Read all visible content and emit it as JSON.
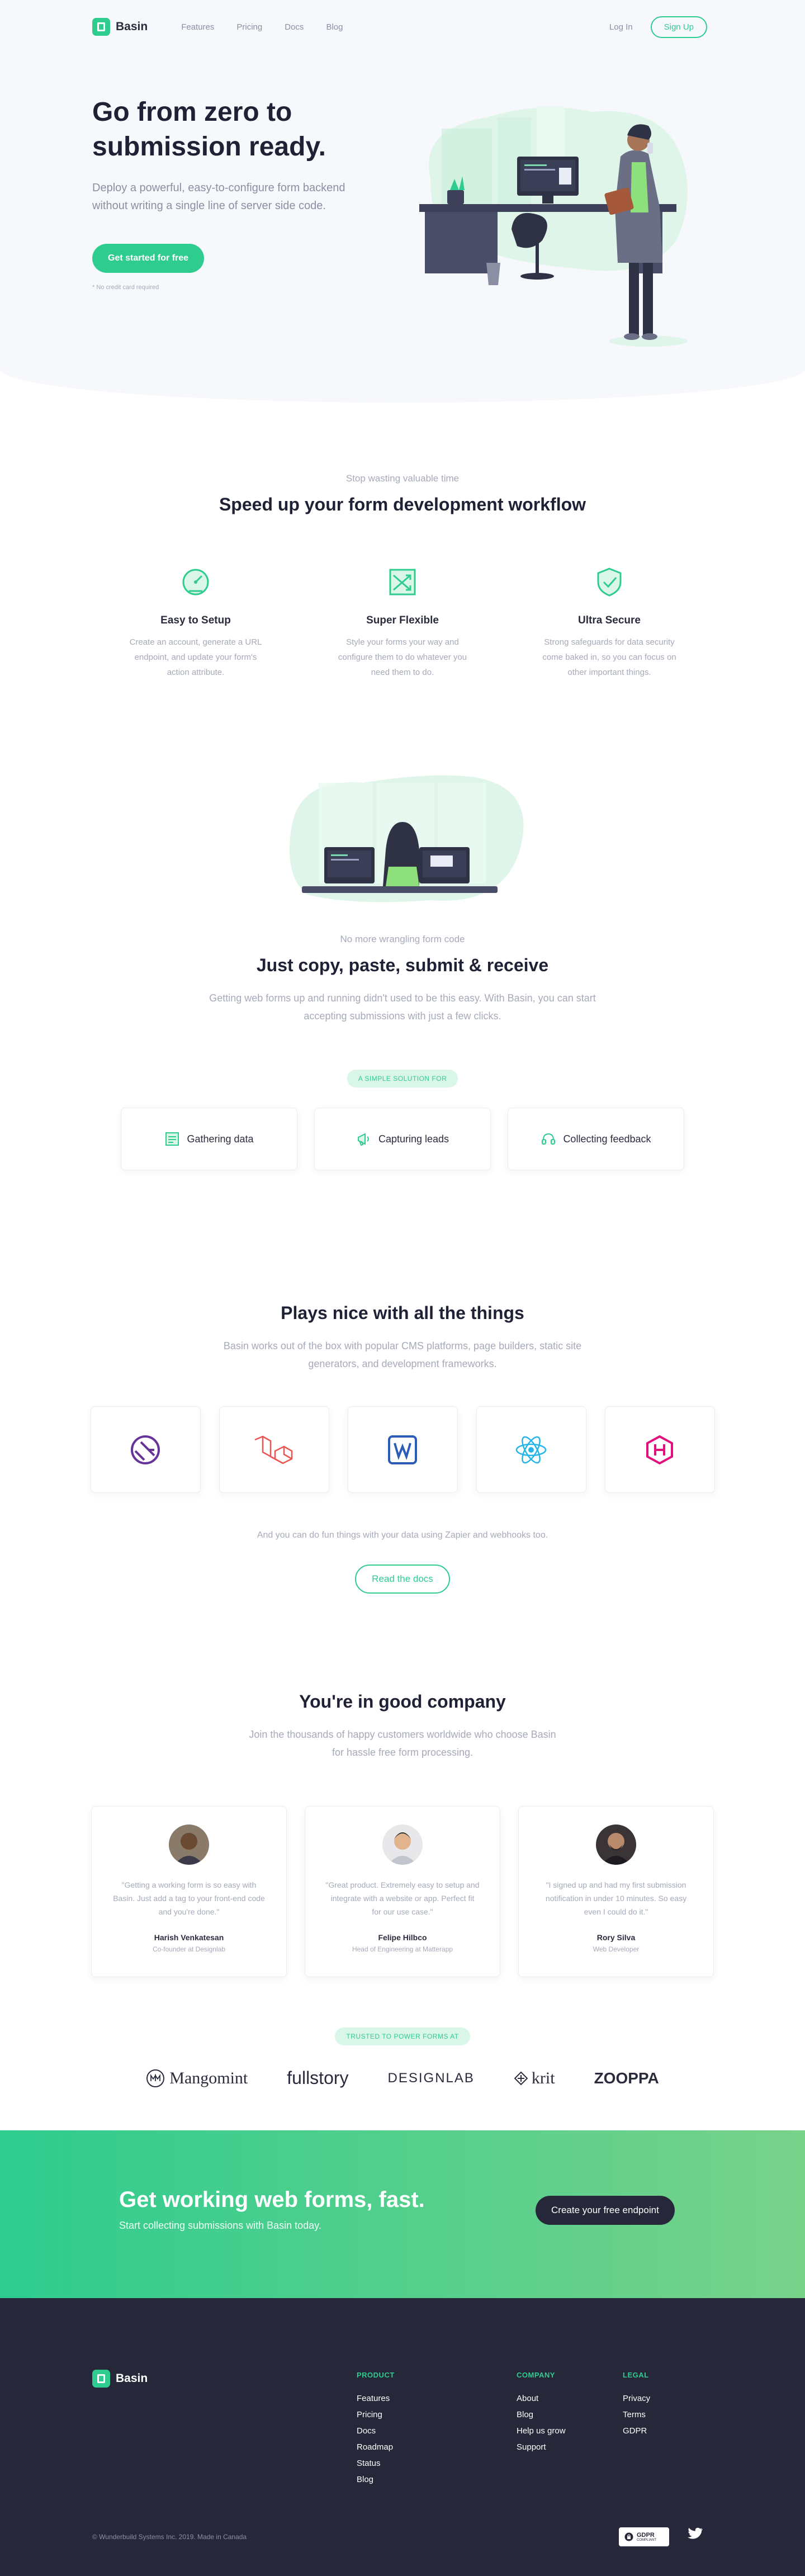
{
  "nav": {
    "brand": "Basin",
    "links": [
      "Features",
      "Pricing",
      "Docs",
      "Blog"
    ],
    "login": "Log In",
    "signup": "Sign Up"
  },
  "hero": {
    "title": "Go from zero to submission ready.",
    "subtitle": "Deploy a powerful, easy-to-configure form backend without writing a single line of server side code.",
    "cta": "Get started for free",
    "note": "* No credit card required"
  },
  "workflow": {
    "eyebrow": "Stop wasting valuable time",
    "title": "Speed up your form development workflow",
    "features": [
      {
        "title": "Easy to Setup",
        "desc": "Create an account, generate a URL endpoint, and update your form's action attribute.",
        "icon": "gauge-icon"
      },
      {
        "title": "Super Flexible",
        "desc": "Style your forms your way and configure them to do whatever you need them to do.",
        "icon": "shuffle-icon"
      },
      {
        "title": "Ultra Secure",
        "desc": "Strong safeguards for data security come baked in, so you can focus on other important things.",
        "icon": "shield-check-icon"
      }
    ]
  },
  "copy_paste": {
    "eyebrow": "No more wrangling form code",
    "title": "Just copy, paste, submit & receive",
    "subtitle": "Getting web forms up and running didn't used to be this easy. With Basin, you can start accepting submissions with just a few clicks.",
    "pill": "A SIMPLE SOLUTION FOR",
    "cards": [
      {
        "label": "Gathering data",
        "icon": "form-icon"
      },
      {
        "label": "Capturing leads",
        "icon": "megaphone-icon"
      },
      {
        "label": "Collecting feedback",
        "icon": "headset-icon"
      }
    ]
  },
  "integrations": {
    "title": "Plays nice with all the things",
    "subtitle": "Basin works out of the box with popular CMS platforms, page builders, static site generators, and development frameworks.",
    "items": [
      "gatsby-icon",
      "laravel-icon",
      "wordpress-icon",
      "react-icon",
      "hugo-icon"
    ],
    "note": "And you can do fun things with your data using Zapier and webhooks too.",
    "button": "Read the docs"
  },
  "testimonials": {
    "title": "You're in good company",
    "subtitle": "Join the thousands of happy customers worldwide who choose Basin for hassle free form processing.",
    "items": [
      {
        "quote": "\"Getting a working form is so easy with Basin. Just add a tag to your front-end code and you're done.\"",
        "name": "Harish Venkatesan",
        "role": "Co-founder at Designlab"
      },
      {
        "quote": "\"Great product. Extremely easy to setup and integrate with a website or app. Perfect fit for our use case.\"",
        "name": "Felipe Hilbco",
        "role": "Head of Engineering at Matterapp"
      },
      {
        "quote": "\"I signed up and had my first submission notification in under 10 minutes. So easy even I could do it.\"",
        "name": "Rory Silva",
        "role": "Web Developer"
      }
    ],
    "pill": "TRUSTED TO POWER FORMS AT",
    "logos": [
      "Mangomint",
      "fullstory",
      "DESIGNLAB",
      "krit",
      "ZOOPPA"
    ]
  },
  "cta": {
    "title": "Get working web forms, fast.",
    "subtitle": "Start collecting submissions with Basin today.",
    "button": "Create your free endpoint"
  },
  "footer": {
    "brand": "Basin",
    "columns": [
      {
        "heading": "PRODUCT",
        "links": [
          "Features",
          "Pricing",
          "Docs",
          "Roadmap",
          "Status",
          "Blog"
        ]
      },
      {
        "heading": "COMPANY",
        "links": [
          "About",
          "Blog",
          "Help us grow",
          "Support"
        ]
      },
      {
        "heading": "LEGAL",
        "links": [
          "Privacy",
          "Terms",
          "GDPR"
        ]
      }
    ],
    "copyright": "© Wunderbuild Systems Inc. 2019. Made in Canada",
    "gdpr_main": "GDPR",
    "gdpr_sub": "COMPLIANT"
  },
  "colors": {
    "accent": "#2ecc8f",
    "dark": "#262839",
    "muted": "#a6aab9"
  }
}
